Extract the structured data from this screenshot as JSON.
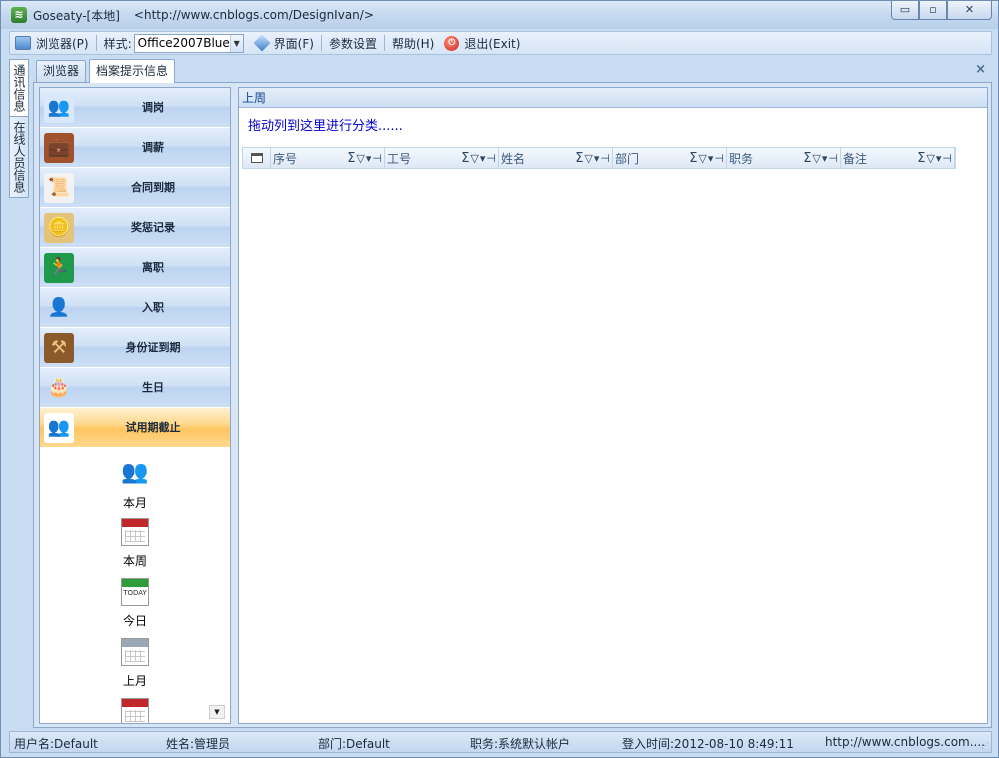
{
  "window": {
    "title": "Goseaty-[本地]",
    "url": "<http://www.cnblogs.com/DesignIvan/>",
    "app_icon_glyph": "≋",
    "buttons": {
      "minimize": "▭",
      "maximize": "▫",
      "close": "✕"
    }
  },
  "menu": {
    "browser": "浏览器(P)",
    "style_label": "样式:",
    "style_value": "Office2007Blue",
    "interface": "界面(F)",
    "params": "参数设置",
    "help": "帮助(H)",
    "exit": "退出(Exit)"
  },
  "side_tabs": [
    "通讯信息",
    "在线人员信息"
  ],
  "tabs": [
    {
      "label": "浏览器",
      "active": false
    },
    {
      "label": "档案提示信息",
      "active": true
    }
  ],
  "tab_close": "×",
  "navbar": {
    "groups": [
      {
        "label": "调岗",
        "icon": "people-swap-icon",
        "glyph": "👥",
        "color": "#d9e8fb"
      },
      {
        "label": "调薪",
        "icon": "wallet-icon",
        "glyph": "💼",
        "color": "#a0522d"
      },
      {
        "label": "合同到期",
        "icon": "contract-icon",
        "glyph": "📜",
        "color": "#f2f2f2"
      },
      {
        "label": "奖惩记录",
        "icon": "coins-icon",
        "glyph": "🪙",
        "color": "#e3c47a"
      },
      {
        "label": "离职",
        "icon": "exit-sign-icon",
        "glyph": "🏃",
        "color": "#1f9a4b"
      },
      {
        "label": "入职",
        "icon": "person-icon",
        "glyph": "👤",
        "color": "#cfe0f6"
      },
      {
        "label": "身份证到期",
        "icon": "id-stamp-icon",
        "glyph": "⚒",
        "color": "#8b5a2b"
      },
      {
        "label": "生日",
        "icon": "birthday-cake-icon",
        "glyph": "🎂",
        "color": "#cfe0f6"
      },
      {
        "label": "试用期截止",
        "icon": "probation-people-icon",
        "glyph": "👥",
        "color": "#ffffff",
        "active": true
      }
    ],
    "items": [
      {
        "label": "本月",
        "icon": "people-group-icon"
      },
      {
        "label": "本周",
        "icon": "calendar-red-icon"
      },
      {
        "label": "今日",
        "icon": "calendar-today-icon",
        "badge": "TODAY"
      },
      {
        "label": "上月",
        "icon": "calendar-grid-icon"
      }
    ],
    "scroll_down": "▼"
  },
  "grid": {
    "caption": "上周",
    "group_panel_hint": "拖动列到这里进行分类......",
    "columns": [
      "序号",
      "工号",
      "姓名",
      "部门",
      "职务",
      "备注"
    ],
    "column_tools": {
      "sigma": "Σ",
      "filter": "▽",
      "dropdown": "▾",
      "pin": "⊣"
    }
  },
  "status": {
    "user": "用户名:Default",
    "name": "姓名:管理员",
    "dept": "部门:Default",
    "role": "职务:系统默认帐户",
    "login_time": "登入时间:2012-08-10 8:49:11",
    "link": "http://www.cnblogs.com...."
  }
}
